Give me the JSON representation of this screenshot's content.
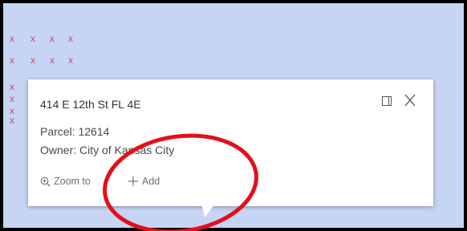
{
  "map": {
    "markers": [
      "x",
      "x",
      "x",
      "x",
      "x",
      "x",
      "x",
      "x",
      "x",
      "x",
      "x",
      "x"
    ],
    "marker_color": "#d9485d",
    "background_color": "#c6d5f4"
  },
  "popup": {
    "title": "414 E 12th St FL 4E",
    "dock_icon": "dock-panel-icon",
    "close_icon": "close-icon",
    "fields": {
      "parcel": "Parcel: 12614",
      "owner": "Owner: City of Kansas City"
    },
    "actions": {
      "zoom_label": "Zoom to",
      "zoom_icon": "zoom-in-icon",
      "add_label": "Add",
      "add_icon": "plus-icon"
    }
  },
  "annotation": {
    "shape": "ellipse",
    "color": "#e3101a"
  }
}
